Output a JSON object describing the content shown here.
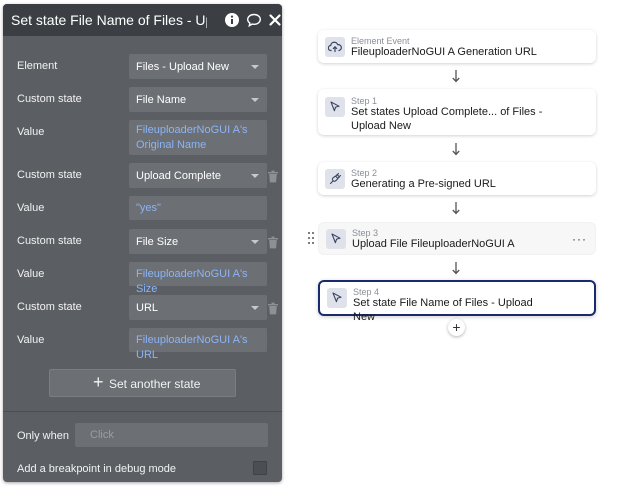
{
  "panel": {
    "title": "Set state File Name of Files - Upl",
    "icons": [
      "info-icon",
      "comment-icon",
      "close-icon"
    ],
    "rows": [
      {
        "label": "Element",
        "kind": "select",
        "value": "Files - Upload New"
      },
      {
        "label": "Custom state",
        "kind": "select",
        "value": "File Name"
      },
      {
        "label": "Value",
        "kind": "value",
        "value_line1": "FileuploaderNoGUI A's",
        "value_line2": "Original Name"
      },
      {
        "label": "Custom state",
        "kind": "select",
        "value": "Upload Complete"
      },
      {
        "label": "Value",
        "kind": "value",
        "value_line1": "\"yes\""
      },
      {
        "label": "Custom state",
        "kind": "select",
        "value": "File Size"
      },
      {
        "label": "Value",
        "kind": "value",
        "value_line1": "FileuploaderNoGUI A's Size"
      },
      {
        "label": "Custom state",
        "kind": "select",
        "value": "URL"
      },
      {
        "label": "Value",
        "kind": "value",
        "value_line1": "FileuploaderNoGUI A's URL"
      }
    ],
    "set_another_label": "Set another state",
    "only_when_label": "Only when",
    "only_when_placeholder": "Click",
    "breakpoint_label": "Add a breakpoint in debug mode"
  },
  "workflow": {
    "event": {
      "label": "Element Event",
      "title": "FileuploaderNoGUI A Generation URL",
      "icon": "upload-cloud-icon"
    },
    "steps": [
      {
        "label": "Step 1",
        "title": "Set states Upload Complete... of Files - Upload New",
        "icon": "cursor-icon"
      },
      {
        "label": "Step 2",
        "title": "Generating a Pre-signed URL",
        "icon": "plug-icon"
      },
      {
        "label": "Step 3",
        "title": "Upload File FileuploaderNoGUI A",
        "icon": "cursor-icon",
        "menu": "···"
      },
      {
        "label": "Step 4",
        "title": "Set state File Name of Files - Upload New",
        "icon": "cursor-icon"
      }
    ],
    "add_label": "+"
  },
  "colors": {
    "panel_bg": "#5b5f63",
    "header_bg": "#3b3f43",
    "field_bg": "#6c7074",
    "value_text": "#8ab4f8",
    "selected_border": "#1a2b6b"
  }
}
